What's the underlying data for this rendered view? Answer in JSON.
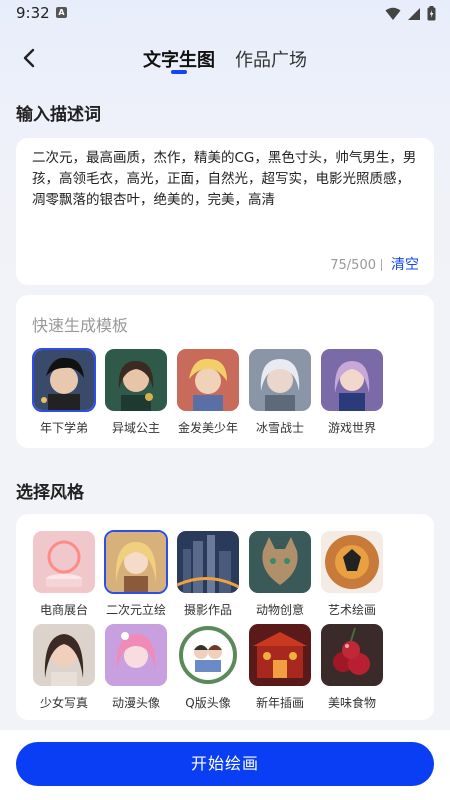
{
  "status": {
    "time": "9:32",
    "notification_letter": "A"
  },
  "nav": {
    "tab_active": "文字生图",
    "tab_inactive": "作品广场"
  },
  "prompt_section": {
    "title": "输入描述词",
    "text": "二次元，最高画质，杰作，精美的CG，黑色寸头，帅气男生，男孩，高领毛衣，高光，正面，自然光，超写实，电影光照质感，凋零飘落的银杏叶，绝美的，完美，高清",
    "counter": "75/500",
    "clear_label": "清空"
  },
  "quick_templates": {
    "title": "快速生成模板",
    "items": [
      {
        "label": "年下学弟",
        "selected": true
      },
      {
        "label": "异域公主",
        "selected": false
      },
      {
        "label": "金发美少年",
        "selected": false
      },
      {
        "label": "冰雪战士",
        "selected": false
      },
      {
        "label": "游戏世界",
        "selected": false
      }
    ]
  },
  "style_section": {
    "title": "选择风格",
    "items": [
      {
        "label": "电商展台",
        "selected": false
      },
      {
        "label": "二次元立绘",
        "selected": true
      },
      {
        "label": "摄影作品",
        "selected": false
      },
      {
        "label": "动物创意",
        "selected": false
      },
      {
        "label": "艺术绘画",
        "selected": false
      },
      {
        "label": "少女写真",
        "selected": false
      },
      {
        "label": "动漫头像",
        "selected": false
      },
      {
        "label": "Q版头像",
        "selected": false
      },
      {
        "label": "新年插画",
        "selected": false
      },
      {
        "label": "美味食物",
        "selected": false
      }
    ]
  },
  "action": {
    "start_label": "开始绘画"
  },
  "colors": {
    "accent": "#0a3ef5",
    "selected_border": "#2d4ee8",
    "link": "#1446f2"
  }
}
